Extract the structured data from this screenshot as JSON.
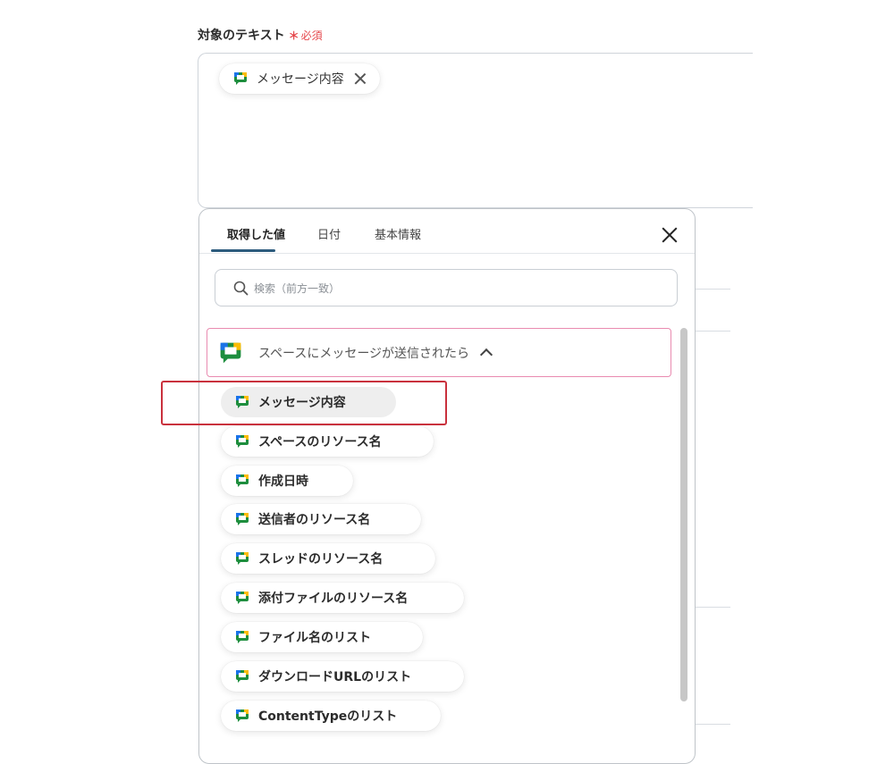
{
  "form": {
    "label": "対象のテキスト",
    "required_mark": "＊",
    "required_text": "必須",
    "selected_chip": "メッセージ内容"
  },
  "panel": {
    "tabs": [
      "取得した値",
      "日付",
      "基本情報"
    ],
    "active_tab": "取得した値",
    "search_placeholder": "検索（前方一致）",
    "group_label": "スペースにメッセージが送信されたら",
    "items": [
      "メッセージ内容",
      "スペースのリソース名",
      "作成日時",
      "送信者のリソース名",
      "スレッドのリソース名",
      "添付ファイルのリソース名",
      "ファイル名のリスト",
      "ダウンロードURLのリスト",
      "ContentTypeのリスト"
    ],
    "selected_item": "メッセージ内容"
  },
  "colors": {
    "tab_underline": "#2c5b7d",
    "group_border": "#e98bb0",
    "highlight_border": "#c9313d",
    "required": "#e5484d"
  },
  "icons": {
    "chat": "google-chat-icon",
    "search": "search-icon",
    "close": "close-icon",
    "chevron": "chevron-up-icon"
  }
}
